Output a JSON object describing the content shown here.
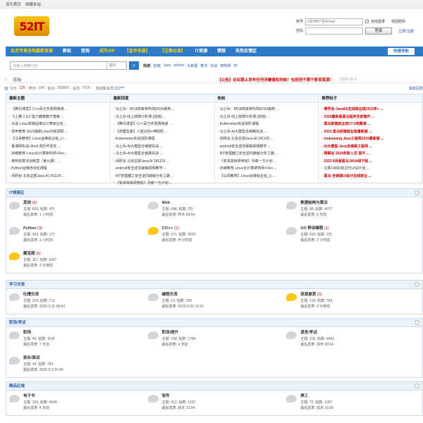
{
  "topbar": {
    "home": "设为首页",
    "fav": "收藏本站"
  },
  "logo": {
    "text": "52IT"
  },
  "login": {
    "account_label": "帐号",
    "account_placeholder": "UID/用户名/Email",
    "password_label": "密码",
    "auto_login": "自动登录",
    "forgot": "找回密码",
    "login_button": "登录",
    "register": "立即注册"
  },
  "nav": {
    "items": [
      "会员专享全网最新资源",
      "新帖",
      "签到",
      "成为VIP",
      "【金币充值】",
      "【注意必读】",
      "IT资源",
      "情报",
      "失效反馈区"
    ],
    "quick": "快捷导航"
  },
  "search": {
    "placeholder": "请输入搜索内容",
    "type": "帖子",
    "hot_label": "热搜:",
    "keywords": [
      "前端",
      "Java",
      "python",
      "大数据",
      "算法",
      "实战",
      "架构师",
      "go"
    ]
  },
  "breadcrumb": {
    "home_icon": "home-icon",
    "current": "论坛",
    "notice": "【公告】论坛禁止发布任何涉嫌侵权的帖！包括但不限于影视资源！",
    "date": "(2022-11-3"
  },
  "stats": {
    "today_label": "今日:",
    "today": "125",
    "yesterday_label": "昨日:",
    "yesterday": "154",
    "posts_label": "帖子:",
    "posts": "293600",
    "members_label": "会员:",
    "members": "7676",
    "newest_label": "欢迎新会员:",
    "newest": "222***",
    "latest_replies": "最新回复"
  },
  "overview": [
    {
      "title": "最新主题",
      "items": [
        {
          "text": "【腾讯课堂】C++百万并发网络通 ...",
          "red": false
        },
        {
          "text": "飞上腾 1.9.2 能力教教教于摸索 ...",
          "red": false
        },
        {
          "text": "马哥-Linux高端运维云计算就业班 ...",
          "red": false
        },
        {
          "text": "零声教育-2023最新Linux内核调研 ...",
          "red": false
        },
        {
          "text": "【马哥教育】Linux运维就业班_Li ...",
          "red": false
        },
        {
          "text": "慕课网实战-Shell 高阶开发实 ...",
          "red": false
        },
        {
          "text": "京峰教育-Linux云计算架构师+Dev ...",
          "red": false
        },
        {
          "text": "奥特克算法训练营（第九期）...",
          "red": false
        },
        {
          "text": "Python运维自动化课程",
          "red": false
        },
        {
          "text": "闲研谷 北京总部Java AI 241125 ...",
          "red": false
        }
      ]
    },
    {
      "title": "最新回复",
      "items": [
        {
          "text": "马士兵：MCA高级架构师[2024最新 ...",
          "red": false
        },
        {
          "text": "马士兵 线上故障分析课 [完结] ...",
          "red": false
        },
        {
          "text": "【腾讯课堂】C++百万并发网络通 ...",
          "red": false
        },
        {
          "text": "【虎踞龙盘】人脸识别+神经网 ...",
          "red": false
        },
        {
          "text": "Kubernetes实战进阶课程",
          "red": false
        },
        {
          "text": "马士兵-AI大模型全链路实战 ...",
          "red": false
        },
        {
          "text": "马士兵-AI大模型全链路实战 ...",
          "red": false
        },
        {
          "text": "闲研谷 北京总部Java AI 241125 ...",
          "red": false
        },
        {
          "text": "android安全逆向破解视频教学 ...",
          "red": false
        },
        {
          "text": "MT管理器之安全逆向破解分析之路 ...",
          "red": false
        },
        {
          "text": "《安卓高级研修班》月薪一万计划 ...",
          "red": false
        }
      ]
    },
    {
      "title": "热帖",
      "items": [
        {
          "text": "马士兵：MCA高级架构师[2024最新 ...",
          "red": false
        },
        {
          "text": "马士兵 线上故障分析课 [完结] ...",
          "red": false
        },
        {
          "text": "Kubernetes实战进阶课程",
          "red": false
        },
        {
          "text": "马士兵-AI大模型全链路实战 ...",
          "red": false
        },
        {
          "text": "闲研谷 北京总部Java AI 241125 ...",
          "red": false
        },
        {
          "text": "android安全逆向破解视频教学 ...",
          "red": false
        },
        {
          "text": "MT管理器之安全逆向破解分析之路 ...",
          "red": false
        },
        {
          "text": "《安卓高级研修班》月薪一万计划 ...",
          "red": false
        },
        {
          "text": "京峰教育-Linux云计算架构师+Dev ...",
          "red": false
        },
        {
          "text": "【马哥教育】Linux运维就业班_Li ...",
          "red": false
        }
      ]
    },
    {
      "title": "推荐帖子",
      "items": [
        {
          "text": "博学谷-JavaEE在线就业班2023年+ ...",
          "red": true
        },
        {
          "text": "2025最新版黑马程序员前端开 ...",
          "red": true
        },
        {
          "text": "黑马前端就业班V7.0完整课 ...",
          "red": true
        },
        {
          "text": "2023 黑马前端就业班最新版 ...",
          "red": true
        },
        {
          "text": "mukewang Java工程师2023最新版 ...",
          "red": true
        },
        {
          "text": "AI大模型-Java全链路工程师 ...",
          "red": true
        },
        {
          "text": "网赋谷 2024年新入式 提不 ...",
          "red": true
        },
        {
          "text": "2023 8月版黑马JAVA线下就 ...",
          "red": true
        },
        {
          "text": "汪侯19800前沿代UI设计班 ...",
          "red": false
        },
        {
          "text": "黑马-全链路UI设计在线就业 ...",
          "red": true
        }
      ]
    }
  ],
  "sections": [
    {
      "title": "IT情报区",
      "forums": [
        {
          "name": "其他",
          "today": "(9)",
          "topics": "828",
          "posts": "4万",
          "last": "1 小时前",
          "new": false
        },
        {
          "name": "Web",
          "today": "",
          "topics": "598",
          "posts": "2万",
          "last": "昨天 09:54",
          "new": false
        },
        {
          "name": "数据结构与算法",
          "today": "",
          "topics": "88",
          "posts": "4077",
          "last": "6 天前",
          "new": false
        },
        {
          "name": "Python",
          "today": "(3)",
          "topics": "363",
          "posts": "1万",
          "last": "1 小时前",
          "new": false
        },
        {
          "name": "C/C++",
          "today": "(2)",
          "topics": "271",
          "posts": "9515",
          "last": "半小时前",
          "new": true
        },
        {
          "name": "GO 移动编程",
          "today": "(1)",
          "topics": "620",
          "posts": "2万",
          "last": "3 小时前",
          "new": false
        },
        {
          "name": "藏宝阁",
          "today": "(5)",
          "topics": "117",
          "posts": "1667",
          "last": "2 分钟前",
          "new": true
        }
      ]
    },
    {
      "title": "学习交流",
      "forums": [
        {
          "name": "吐槽交流",
          "today": "",
          "topics": "318",
          "posts": "711",
          "last": "2025-3-11 09:50",
          "new": false
        },
        {
          "name": "编程交流",
          "today": "",
          "topics": "13",
          "posts": "339",
          "last": "2025-5-22 12:21",
          "new": false
        },
        {
          "name": "资源悬赏",
          "today": "(3)",
          "topics": "219",
          "posts": "763",
          "last": "3 分钟前",
          "new": true
        }
      ]
    },
    {
      "title": "职场/考试",
      "forums": [
        {
          "name": "职场",
          "today": "",
          "topics": "49",
          "posts": "1142",
          "last": "7 天前",
          "new": false
        },
        {
          "name": "职场/提升",
          "today": "",
          "topics": "108",
          "posts": "1784",
          "last": "4 天前",
          "new": false
        },
        {
          "name": "语言/考试",
          "today": "",
          "topics": "225",
          "posts": "4401",
          "last": "前天 09:04",
          "new": false
        },
        {
          "name": "就业/面试",
          "today": "",
          "topics": "24",
          "posts": "793",
          "last": "2025-5-3 22:49",
          "new": false
        }
      ]
    },
    {
      "title": "精品区域",
      "forums": [
        {
          "name": "电子书",
          "today": "",
          "topics": "153",
          "posts": "4644",
          "last": "4 天前",
          "new": false
        },
        {
          "name": "软件",
          "today": "",
          "topics": "412",
          "posts": "1237",
          "last": "前天 22:04",
          "new": false
        },
        {
          "name": "美工",
          "today": "",
          "topics": "72",
          "posts": "1357",
          "last": "前天 16:00",
          "new": false
        }
      ]
    }
  ],
  "labels": {
    "topics": "主题:",
    "posts": "帖数:",
    "last": "最后发表:"
  }
}
